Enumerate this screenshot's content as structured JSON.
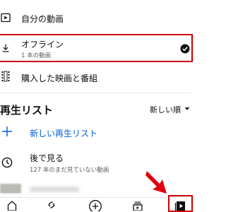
{
  "library": {
    "my_videos": {
      "label": "自分の動画"
    },
    "offline": {
      "label": "オフライン",
      "sub": "1 本の動画"
    },
    "purchases": {
      "label": "購入した映画と番組"
    }
  },
  "playlists": {
    "title": "再生リスト",
    "sort_label": "新しい順",
    "new_playlist_label": "新しい再生リスト",
    "watch_later": {
      "label": "後で見る",
      "sub": "127 本のまだ見ていない動画"
    }
  },
  "colors": {
    "accent": "#065fd4",
    "highlight": "#cc0000",
    "text": "#0f0f0f",
    "secondary_text": "#606060"
  },
  "bottom_nav": {
    "items": [
      {
        "icon": "home-icon"
      },
      {
        "icon": "shorts-icon"
      },
      {
        "icon": "create-icon"
      },
      {
        "icon": "subscriptions-icon"
      },
      {
        "icon": "library-icon",
        "selected": true
      }
    ]
  }
}
